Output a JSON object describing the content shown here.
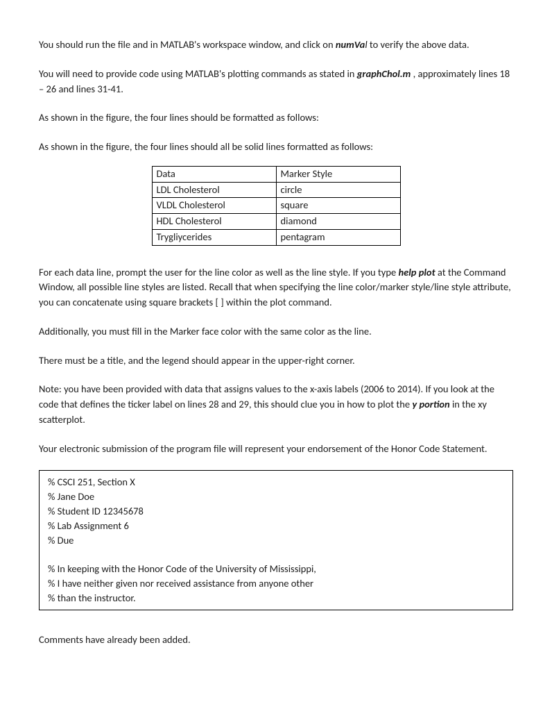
{
  "p1_a": "You should run the file and in MATLAB's workspace window, and click on ",
  "p1_b": "numVa",
  "p1_c": "l",
  "p1_d": " to verify the above data.",
  "p2_a": "You will need to provide code using MATLAB's plotting commands as stated in ",
  "p2_b": "graphChol.m",
  "p2_c": " , approximately lines 18 – 26 and lines 31-41.",
  "p3": "As shown in the figure, the four lines should be formatted as follows:",
  "p4": "As shown in the figure, the four lines should all be solid lines formatted as follows:",
  "table": {
    "h1": "Data",
    "h2": "Marker Style",
    "r1a": "LDL Cholesterol",
    "r1b": "circle",
    "r2a": "VLDL Cholesterol",
    "r2b": "square",
    "r3a": "HDL Cholesterol",
    "r3b": "diamond",
    "r4a": "Trygliycerides",
    "r4b": "pentagram"
  },
  "p5_a": "For each data line, prompt the user for the line color as well as the line style. If you type ",
  "p5_b": "help plot",
  "p5_c": " at the Command Window, all possible line styles are listed. Recall that when specifying the line color/marker style/line style attribute, you can concatenate using square brackets [ ] within the plot command.",
  "p6": "Additionally, you must fill in the Marker face color with the same color as the line.",
  "p7": "There must be a title, and the legend should appear in the upper-right corner.",
  "p8_a": "Note:  you have been provided with data that assigns values to the x-axis labels (2006 to 2014). If you look at the code that defines the ticker label on lines 28 and 29, this should clue you in how to plot the ",
  "p8_b": "y portion",
  "p8_c": " in the xy scatterplot.",
  "p9": "Your electronic submission of the program file will represent your endorsement of the Honor Code Statement.",
  "code": {
    "l1": "% CSCI 251, Section X",
    "l2": "% Jane Doe",
    "l3": "% Student ID 12345678",
    "l4": "% Lab Assignment 6",
    "l5": "% Due",
    "l6": "% In keeping with the Honor Code of the University of Mississippi,",
    "l7": "% I have neither given nor received assistance from anyone other",
    "l8": "% than the instructor."
  },
  "p10": "Comments have already been added."
}
